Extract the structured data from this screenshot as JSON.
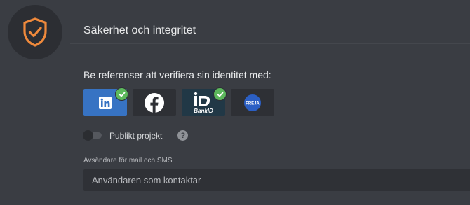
{
  "header": {
    "title": "Säkerhet och integritet",
    "icon": "shield-check-icon",
    "accent": "#f08a3c"
  },
  "verify": {
    "heading": "Be referenser att verifiera sin identitet med:",
    "providers": [
      {
        "name": "linkedin",
        "icon": "linkedin-icon",
        "bg": "#3773c3",
        "checked": true
      },
      {
        "name": "facebook",
        "icon": "facebook-icon",
        "bg": "#2e3035",
        "checked": false
      },
      {
        "name": "bankid",
        "icon": "bankid-icon",
        "bg": "#213846",
        "checked": true,
        "logo_text": "BankID"
      },
      {
        "name": "freja",
        "icon": "freja-icon",
        "bg": "#2e3035",
        "checked": false,
        "logo_text": "FREJA"
      }
    ],
    "check_color": "#5cb85c"
  },
  "public_project": {
    "label": "Publikt projekt",
    "enabled": false,
    "help": "?"
  },
  "sender": {
    "label": "Avsändare för mail och SMS",
    "placeholder": "Användaren som kontaktar"
  }
}
